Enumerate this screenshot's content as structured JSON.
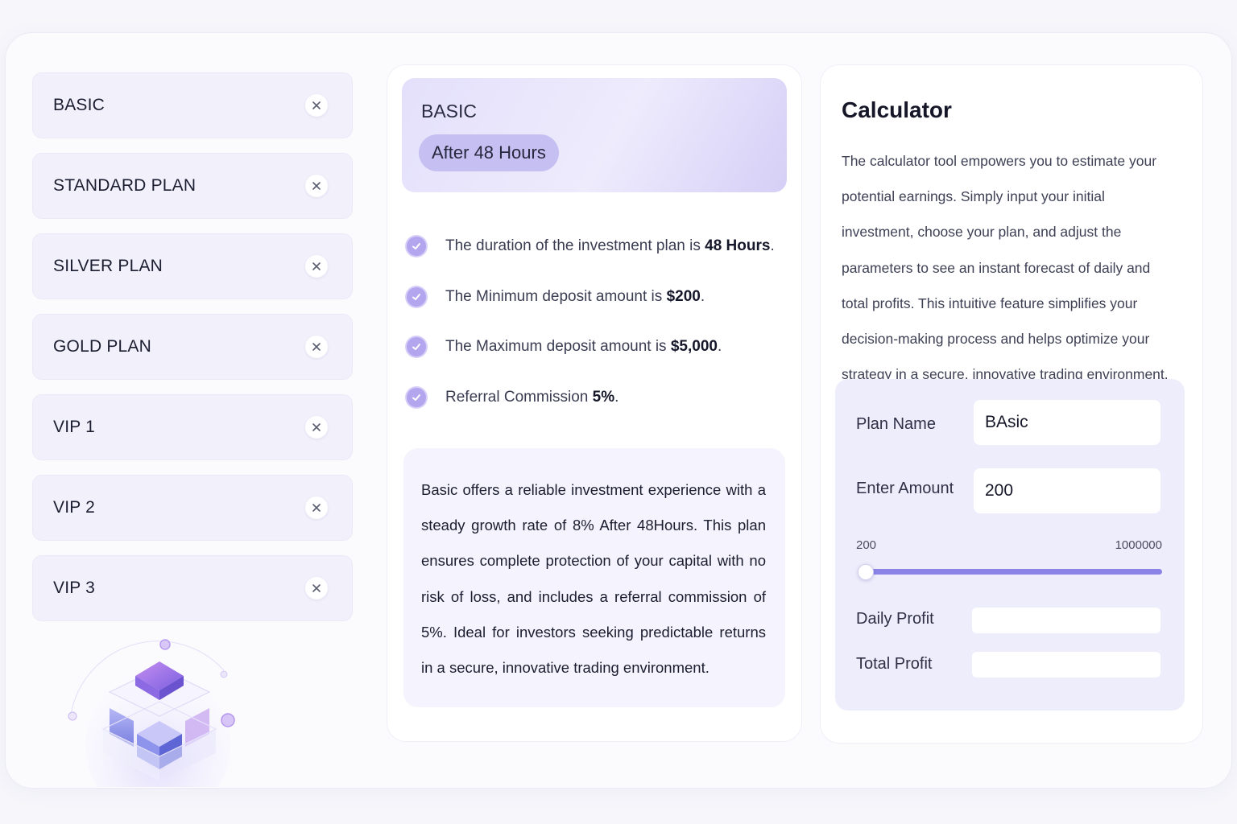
{
  "plans": [
    {
      "label": "BASIC"
    },
    {
      "label": "STANDARD PLAN"
    },
    {
      "label": "SILVER PLAN"
    },
    {
      "label": "GOLD PLAN"
    },
    {
      "label": "VIP 1"
    },
    {
      "label": "VIP 2"
    },
    {
      "label": "VIP 3"
    }
  ],
  "details": {
    "plan_name": "BASIC",
    "duration_badge": "After 48 Hours",
    "features": [
      {
        "text": "The duration of the investment plan is ",
        "value": "48 Hours",
        "suffix": "."
      },
      {
        "text": "The Minimum deposit amount is ",
        "value": "$200",
        "suffix": "."
      },
      {
        "text": "The Maximum deposit amount is ",
        "value": "$5,000",
        "suffix": "."
      },
      {
        "text": "Referral Commission ",
        "value": "5%",
        "suffix": "."
      }
    ],
    "description": "Basic offers a reliable investment experience with a steady growth  rate of 8% After 48Hours. This plan ensures complete protection of your capital with no risk of loss, and includes a referral commission of 5%. Ideal for investors seeking predictable returns in a secure, innovative trading environment."
  },
  "calculator": {
    "title": "Calculator",
    "intro": "The calculator tool empowers you to estimate your potential earnings. Simply input your initial investment, choose your plan, and adjust the parameters to see an instant forecast of daily and total profits. This intuitive feature simplifies your decision-making process and helps optimize your strategy in a secure, innovative trading environment.",
    "plan_name_label": "Plan Name",
    "plan_name_value": "BAsic",
    "amount_label": "Enter Amount",
    "amount_value": "200",
    "range_min": "200",
    "range_max": "1000000",
    "slider_fraction": 0.0,
    "daily_profit_label": "Daily Profit",
    "daily_profit_value": "",
    "total_profit_label": "Total Profit",
    "total_profit_value": ""
  },
  "colors": {
    "accent": "#8b84e6",
    "check": "#b3a5ee",
    "panel_tint": "#eeedfb"
  },
  "icons": {
    "close": "close-icon",
    "check": "check-circle-icon"
  }
}
